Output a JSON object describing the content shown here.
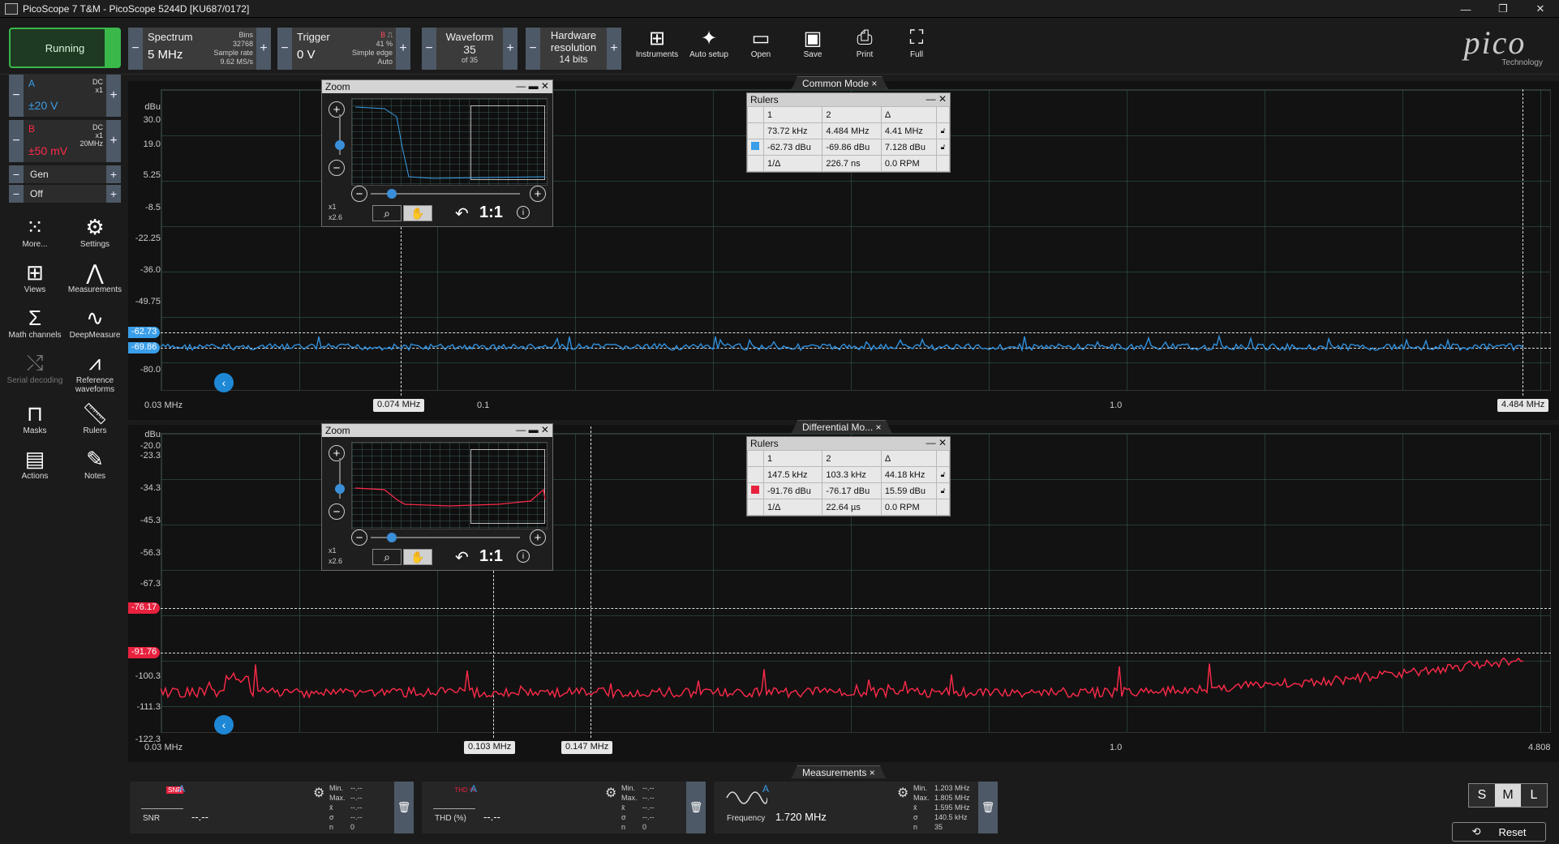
{
  "window": {
    "title": "PicoScope 7 T&M - PicoScope 5244D [KU687/0172]",
    "minimize": "—",
    "restore": "❐",
    "close": "✕"
  },
  "toolbar": {
    "run_status": "Running",
    "spectrum": {
      "label": "Spectrum",
      "value": "5 MHz",
      "bins_label": "Bins",
      "bins": "32768",
      "rate_label": "Sample rate",
      "rate": "9.62 MS/s"
    },
    "trigger": {
      "label": "Trigger",
      "value": "0 V",
      "channel": "B",
      "percent": "41 %",
      "mode": "Simple edge",
      "auto": "Auto"
    },
    "waveform": {
      "label": "Waveform",
      "value": "35",
      "of": "of 35"
    },
    "hw": {
      "label1": "Hardware",
      "label2": "resolution",
      "value": "14 bits"
    },
    "buttons": {
      "instruments": "Instruments",
      "auto_setup": "Auto setup",
      "open": "Open",
      "save": "Save",
      "print": "Print",
      "full": "Full"
    },
    "logo": {
      "word": "pico",
      "sub": "Technology"
    },
    "minus": "−",
    "plus": "+"
  },
  "channels": [
    {
      "name": "A",
      "coupling": "DC",
      "probe": "x1",
      "range": "±20 V",
      "color": "#3a9ee8"
    },
    {
      "name": "B",
      "coupling": "DC",
      "probe": "x1",
      "bw": "20MHz",
      "range": "±50 mV",
      "color": "#ff2a4a"
    }
  ],
  "gen": {
    "label": "Gen"
  },
  "off": {
    "label": "Off"
  },
  "left_tools": {
    "more": "More...",
    "settings": "Settings",
    "views": "Views",
    "measurements": "Measurements",
    "math": "Math channels",
    "deep": "DeepMeasure",
    "serial": "Serial decoding",
    "reference": "Reference waveforms",
    "masks": "Masks",
    "rulers": "Rulers",
    "actions": "Actions",
    "notes": "Notes"
  },
  "view_top": {
    "tab": "Common Mode ×",
    "yunit": "dBu",
    "yticks": [
      "30.0",
      "19.0",
      "5.25",
      "-8.5",
      "-22.25",
      "-36.0",
      "-49.75",
      "-80.0"
    ],
    "ruler_y": [
      "-62.73",
      "-69.86"
    ],
    "xticks": [
      "0.03 MHz",
      "0.1",
      "1.0"
    ],
    "ruler_x": [
      "0.074 MHz",
      "4.484 MHz"
    ]
  },
  "view_bottom": {
    "tab": "Differential Mo... ×",
    "yunit": "dBu",
    "yticks": [
      "-20.0",
      "-23.3",
      "-34.3",
      "-45.3",
      "-56.3",
      "-67.3",
      "-100.3",
      "-111.3",
      "-122.3"
    ],
    "ruler_y": [
      "-76.17",
      "-91.76"
    ],
    "xticks": [
      "0.03 MHz",
      "1.0",
      "4.808"
    ],
    "ruler_x": [
      "0.103 MHz",
      "0.147 MHz"
    ]
  },
  "zoom": {
    "title": "Zoom",
    "x1": "x1",
    "x26": "x2.6",
    "one": "1:1",
    "info": "i",
    "plus": "+",
    "minus": "−"
  },
  "rulers_top": {
    "title": "Rulers",
    "h1": "1",
    "h2": "2",
    "hd": "Δ",
    "r1": [
      "73.72 kHz",
      "4.484 MHz",
      "4.41 MHz"
    ],
    "r2": [
      "-62.73 dBu",
      "-69.86 dBu",
      "7.128 dBu"
    ],
    "r3": [
      "1/Δ",
      "226.7 ns",
      "0.0 RPM"
    ]
  },
  "rulers_bottom": {
    "title": "Rulers",
    "h1": "1",
    "h2": "2",
    "hd": "Δ",
    "r1": [
      "147.5 kHz",
      "103.3 kHz",
      "44.18 kHz"
    ],
    "r2": [
      "-91.76 dBu",
      "-76.17 dBu",
      "15.59 dBu"
    ],
    "r3": [
      "1/Δ",
      "22.64 µs",
      "0.0 RPM"
    ]
  },
  "measurements": {
    "tab": "Measurements ×",
    "cards": [
      {
        "icon": "SNR",
        "ch": "A",
        "label": "SNR",
        "value": "--.--",
        "stats": [
          "Min.",
          "Max.",
          "x̄",
          "σ",
          "n"
        ],
        "svals": [
          "--.--",
          "--.--",
          "--.--",
          "--.--",
          "0"
        ]
      },
      {
        "icon": "THD %",
        "ch": "A",
        "label": "THD (%)",
        "value": "--.--",
        "stats": [
          "Min.",
          "Max.",
          "x̄",
          "σ",
          "n"
        ],
        "svals": [
          "--.--",
          "--.--",
          "--.--",
          "--.--",
          "0"
        ]
      },
      {
        "icon": "",
        "ch": "A",
        "label": "Frequency",
        "value": "1.720 MHz",
        "stats": [
          "Min.",
          "Max.",
          "x̄",
          "σ",
          "n"
        ],
        "svals": [
          "1.203 MHz",
          "1.805 MHz",
          "1.595 MHz",
          "140.5 kHz",
          "35"
        ]
      }
    ]
  },
  "size": {
    "s": "S",
    "m": "M",
    "l": "L"
  },
  "reset": "Reset"
}
